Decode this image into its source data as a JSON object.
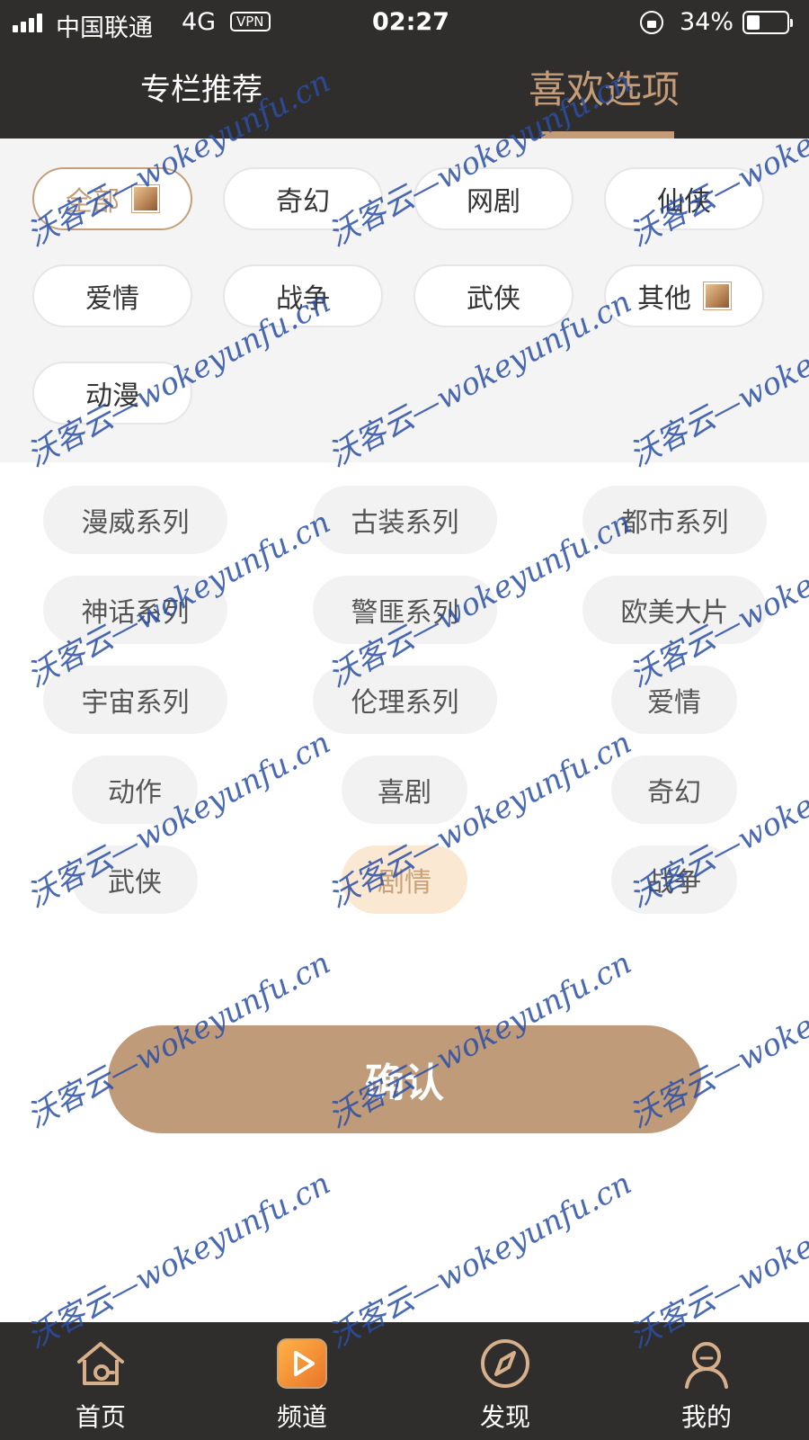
{
  "status_bar": {
    "carrier": "中国联通",
    "network": "4G",
    "vpn": "VPN",
    "time": "02:27",
    "battery_percent": "34%",
    "battery_level": 0.34
  },
  "header": {
    "tabs": [
      {
        "label": "专栏推荐",
        "active": false
      },
      {
        "label": "喜欢选项",
        "active": true
      }
    ]
  },
  "filters": {
    "items": [
      {
        "label": "全部",
        "active": true,
        "badge": true
      },
      {
        "label": "奇幻",
        "active": false,
        "badge": false
      },
      {
        "label": "网剧",
        "active": false,
        "badge": false
      },
      {
        "label": "仙侠",
        "active": false,
        "badge": false
      },
      {
        "label": "爱情",
        "active": false,
        "badge": false
      },
      {
        "label": "战争",
        "active": false,
        "badge": false
      },
      {
        "label": "武侠",
        "active": false,
        "badge": false
      },
      {
        "label": "其他",
        "active": false,
        "badge": true
      },
      {
        "label": "动漫",
        "active": false,
        "badge": false
      }
    ]
  },
  "genres": {
    "items": [
      {
        "label": "漫威系列",
        "selected": false
      },
      {
        "label": "古装系列",
        "selected": false
      },
      {
        "label": "都市系列",
        "selected": false
      },
      {
        "label": "神话系列",
        "selected": false
      },
      {
        "label": "警匪系列",
        "selected": false
      },
      {
        "label": "欧美大片",
        "selected": false
      },
      {
        "label": "宇宙系列",
        "selected": false
      },
      {
        "label": "伦理系列",
        "selected": false
      },
      {
        "label": "爱情",
        "selected": false
      },
      {
        "label": "动作",
        "selected": false
      },
      {
        "label": "喜剧",
        "selected": false
      },
      {
        "label": "奇幻",
        "selected": false
      },
      {
        "label": "武侠",
        "selected": false
      },
      {
        "label": "剧情",
        "selected": true
      },
      {
        "label": "战争",
        "selected": false
      }
    ]
  },
  "confirm_label": "确认",
  "bottom_nav": {
    "items": [
      {
        "label": "首页",
        "icon": "home-icon"
      },
      {
        "label": "频道",
        "icon": "channel-play-icon"
      },
      {
        "label": "发现",
        "icon": "compass-icon"
      },
      {
        "label": "我的",
        "icon": "user-icon"
      }
    ]
  },
  "watermark": "沃客云—wokeyunfu.cn",
  "colors": {
    "dark_bar": "#2f2e2c",
    "accent": "#c49d78",
    "confirm": "#bf9b7a",
    "selected_chip_bg": "#fbe8d3",
    "watermark": "#2b4fa6"
  }
}
